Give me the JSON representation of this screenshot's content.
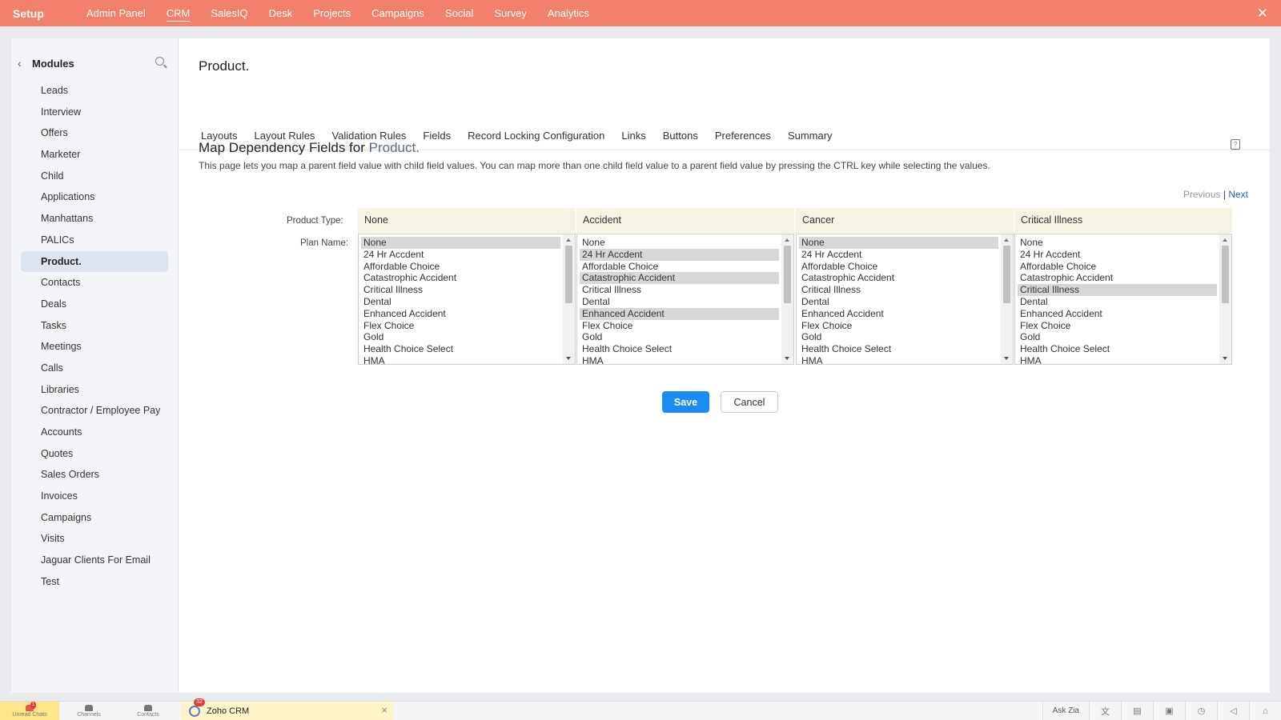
{
  "topbar": {
    "brand": "Setup",
    "nav": [
      "Admin Panel",
      "CRM",
      "SalesIQ",
      "Desk",
      "Projects",
      "Campaigns",
      "Social",
      "Survey",
      "Analytics"
    ],
    "active": "CRM",
    "close_icon": "close-icon"
  },
  "sidebar": {
    "title": "Modules",
    "items": [
      "Leads",
      "Interview",
      "Offers",
      "Marketer",
      "Child",
      "Applications",
      "Manhattans",
      "PALICs",
      "Product.",
      "Contacts",
      "Deals",
      "Tasks",
      "Meetings",
      "Calls",
      "Libraries",
      "Contractor / Employee Pay",
      "Accounts",
      "Quotes",
      "Sales Orders",
      "Invoices",
      "Campaigns",
      "Visits",
      "Jaguar Clients For Email",
      "Test"
    ],
    "active": "Product."
  },
  "main": {
    "page_title": "Product.",
    "tabs": [
      "Layouts",
      "Layout Rules",
      "Validation Rules",
      "Fields",
      "Record Locking Configuration",
      "Links",
      "Buttons",
      "Preferences",
      "Summary"
    ],
    "section_title_prefix": "Map Dependency Fields for",
    "section_title_module": "Product.",
    "description": "This page lets you map a parent field value with child field values. You can map more than one child field value to a parent field value by pressing the CTRL key while selecting the values.",
    "pager": {
      "previous": "Previous",
      "separator": "|",
      "next": "Next"
    },
    "product_type_label": "Product Type:",
    "plan_name_label": "Plan Name:",
    "columns": [
      {
        "parent": "None",
        "options": [
          "None",
          "24 Hr Accdent",
          "Affordable Choice",
          "Catastrophic Accident",
          "Critical Illness",
          "Dental",
          "Enhanced Accident",
          "Flex Choice",
          "Gold",
          "Health Choice Select",
          "HMA"
        ],
        "selected": [
          "None"
        ]
      },
      {
        "parent": "Accident",
        "options": [
          "None",
          "24 Hr Accdent",
          "Affordable Choice",
          "Catastrophic Accident",
          "Critical Illness",
          "Dental",
          "Enhanced Accident",
          "Flex Choice",
          "Gold",
          "Health Choice Select",
          "HMA"
        ],
        "selected": [
          "24 Hr Accdent",
          "Catastrophic Accident",
          "Enhanced Accident"
        ]
      },
      {
        "parent": "Cancer",
        "options": [
          "None",
          "24 Hr Accdent",
          "Affordable Choice",
          "Catastrophic Accident",
          "Critical Illness",
          "Dental",
          "Enhanced Accident",
          "Flex Choice",
          "Gold",
          "Health Choice Select",
          "HMA"
        ],
        "selected": [
          "None"
        ]
      },
      {
        "parent": "Critical Illness",
        "options": [
          "None",
          "24 Hr Accdent",
          "Affordable Choice",
          "Catastrophic Accident",
          "Critical Illness",
          "Dental",
          "Enhanced Accident",
          "Flex Choice",
          "Gold",
          "Health Choice Select",
          "HMA"
        ],
        "selected": [
          "Critical Illness"
        ]
      }
    ],
    "save_label": "Save",
    "cancel_label": "Cancel"
  },
  "bottombar": {
    "left_items": [
      {
        "label": "Unread Chats",
        "icon": "chat-icon",
        "badge": "1"
      },
      {
        "label": "Channels",
        "icon": "channels-icon"
      },
      {
        "label": "Contacts",
        "icon": "contacts-icon"
      }
    ],
    "app_tab": {
      "label": "Zoho CRM",
      "badge": "32"
    },
    "ask_zia": "Ask Zia",
    "right_icons": [
      "translate-icon",
      "notes-icon",
      "screen-icon",
      "alarm-icon",
      "announce-icon",
      "gift-icon"
    ]
  },
  "colors": {
    "topbar": "#f2806a",
    "primary_button": "#1c8cf5",
    "active_module_bg": "#dde4f0",
    "column_header_bg": "#f5f3e4",
    "link": "#1e66c5"
  }
}
